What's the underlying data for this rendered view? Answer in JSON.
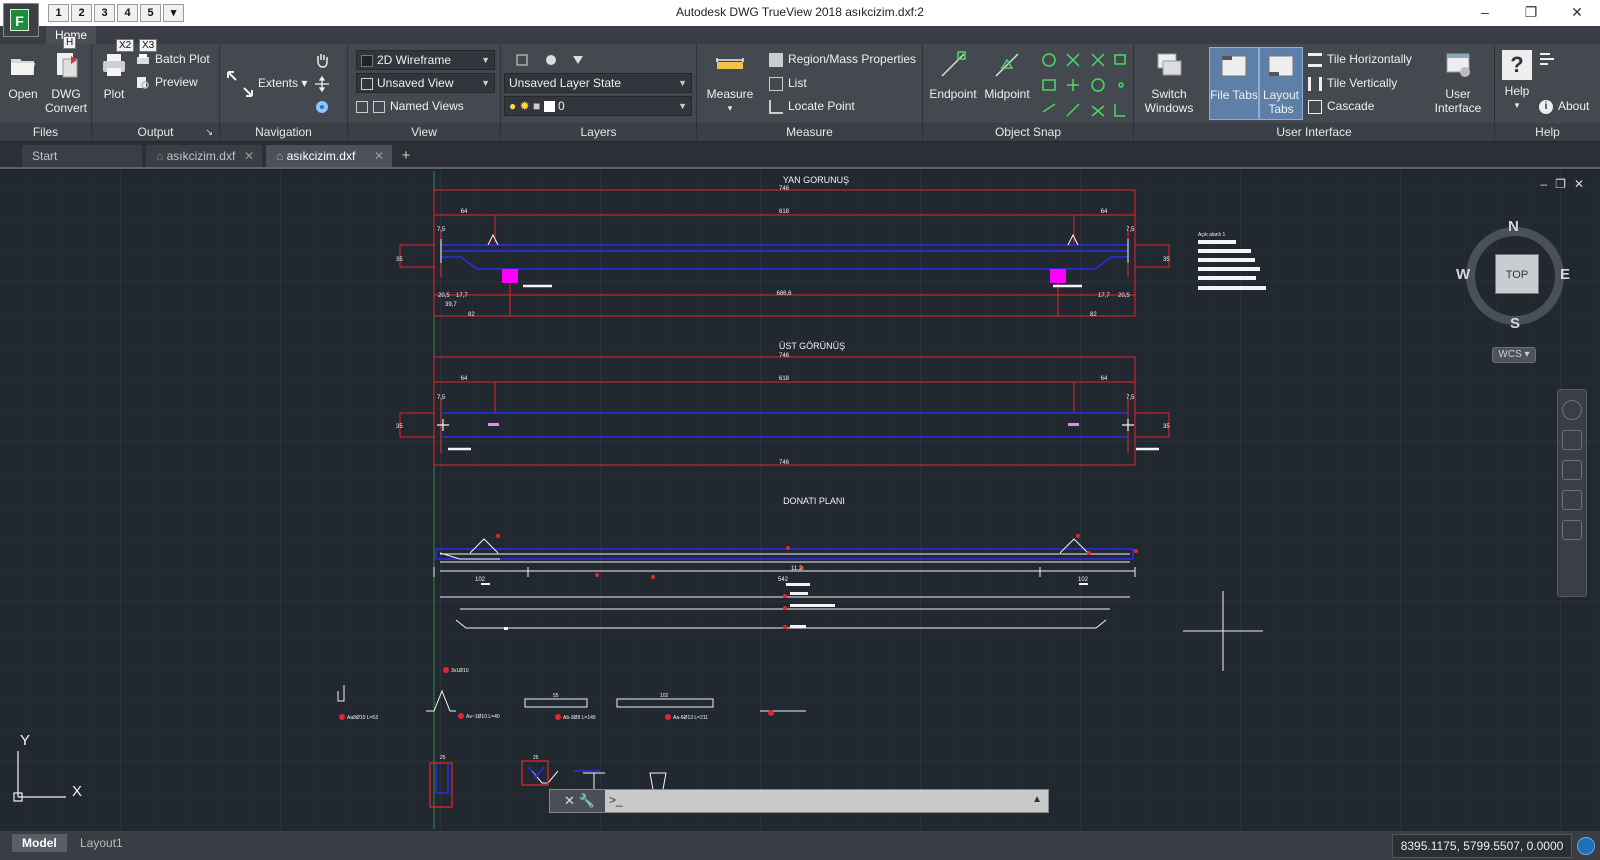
{
  "window": {
    "title": "Autodesk DWG TrueView 2018    asıkcizim.dxf:2",
    "minimize": "–",
    "restore": "❐",
    "close": "✕"
  },
  "quick_access": [
    "1",
    "2",
    "3",
    "4",
    "5"
  ],
  "app_button": {
    "letter": "F",
    "keytip": "F"
  },
  "ribbon_tab": {
    "label": "Home",
    "keytip": "H"
  },
  "keytips": [
    "X2",
    "X3"
  ],
  "panels": {
    "files": {
      "title": "Files",
      "open": "Open",
      "dwg_convert_line1": "DWG",
      "dwg_convert_line2": "Convert"
    },
    "output": {
      "title": "Output",
      "plot": "Plot",
      "batch_plot": "Batch Plot",
      "preview": "Preview"
    },
    "navigation": {
      "title": "Navigation",
      "extents": "Extents"
    },
    "view": {
      "title": "View",
      "visual_style": "2D Wireframe",
      "saved_view": "Unsaved View",
      "named_views": "Named Views"
    },
    "layers": {
      "title": "Layers",
      "layer_state": "Unsaved Layer State",
      "current_layer": "0"
    },
    "measure": {
      "title": "Measure",
      "measure": "Measure",
      "region_mass": "Region/Mass Properties",
      "list": "List",
      "locate_point": "Locate Point"
    },
    "object_snap": {
      "title": "Object Snap",
      "endpoint": "Endpoint",
      "midpoint": "Midpoint"
    },
    "user_interface": {
      "title": "User Interface",
      "switch_windows_line1": "Switch",
      "switch_windows_line2": "Windows",
      "file_tabs_line1": "File Tabs",
      "layout_tabs_line1": "Layout",
      "layout_tabs_line2": "Tabs",
      "tile_horizontally": "Tile Horizontally",
      "tile_vertically": "Tile Vertically",
      "cascade": "Cascade",
      "user_interface_line1": "User",
      "user_interface_line2": "Interface"
    },
    "help": {
      "title": "Help",
      "help": "Help",
      "about": "About"
    }
  },
  "doc_tabs": [
    {
      "label": "Start"
    },
    {
      "label": "asıkcizim.dxf"
    },
    {
      "label": "asıkcizim.dxf"
    }
  ],
  "drawing": {
    "view_side": "YAN GORUNUŞ",
    "view_top": "ÜST GÖRÜNÜŞ",
    "rebar_plan": "DONATI PLANI",
    "dim_total": "746",
    "dim_mid": "618",
    "dim_left": "64",
    "dim_right": "64",
    "dim_side_75": "7,5",
    "dim_bottom": "686,6",
    "dim_205": "20,5",
    "dim_177": "17,7",
    "dim_397": "39,7",
    "dim_82": "82",
    "dim_35": "35",
    "rebar_102": "102",
    "rebar_542": "542",
    "rebar_112": "11,2",
    "legend_title": "Açık alanlı 1",
    "bar5": "Aa8Ø10 L=53",
    "bar4": "As~1Ø10 L=40",
    "bar3": "Ab-3Ø8 L=145",
    "bar2": "Aa-6Ø13 L=211",
    "bar_top": "3x1Ø10",
    "dim_55": "55",
    "dim_102b": "102",
    "dim_25": "25"
  },
  "viewcube": {
    "n": "N",
    "s": "S",
    "e": "E",
    "w": "W",
    "face": "TOP",
    "wcs": "WCS"
  },
  "ucs": {
    "y": "Y",
    "x": "X"
  },
  "viewport_controls": {
    "min": "–",
    "restore": "❐",
    "close": "✕"
  },
  "command": {
    "close": "✕",
    "prompt": ">_"
  },
  "status": {
    "model_tab": "Model",
    "layout_tab": "Layout1",
    "coordinates": "8395.1175, 5799.5507, 0.0000"
  },
  "colors": {
    "red": "#e8242b",
    "blue": "#2a2cf0",
    "magenta": "#ff00ff",
    "white": "#f4f4f4",
    "green": "#2ea24a",
    "grid": "#2a323d",
    "grid_major": "#323b47"
  }
}
